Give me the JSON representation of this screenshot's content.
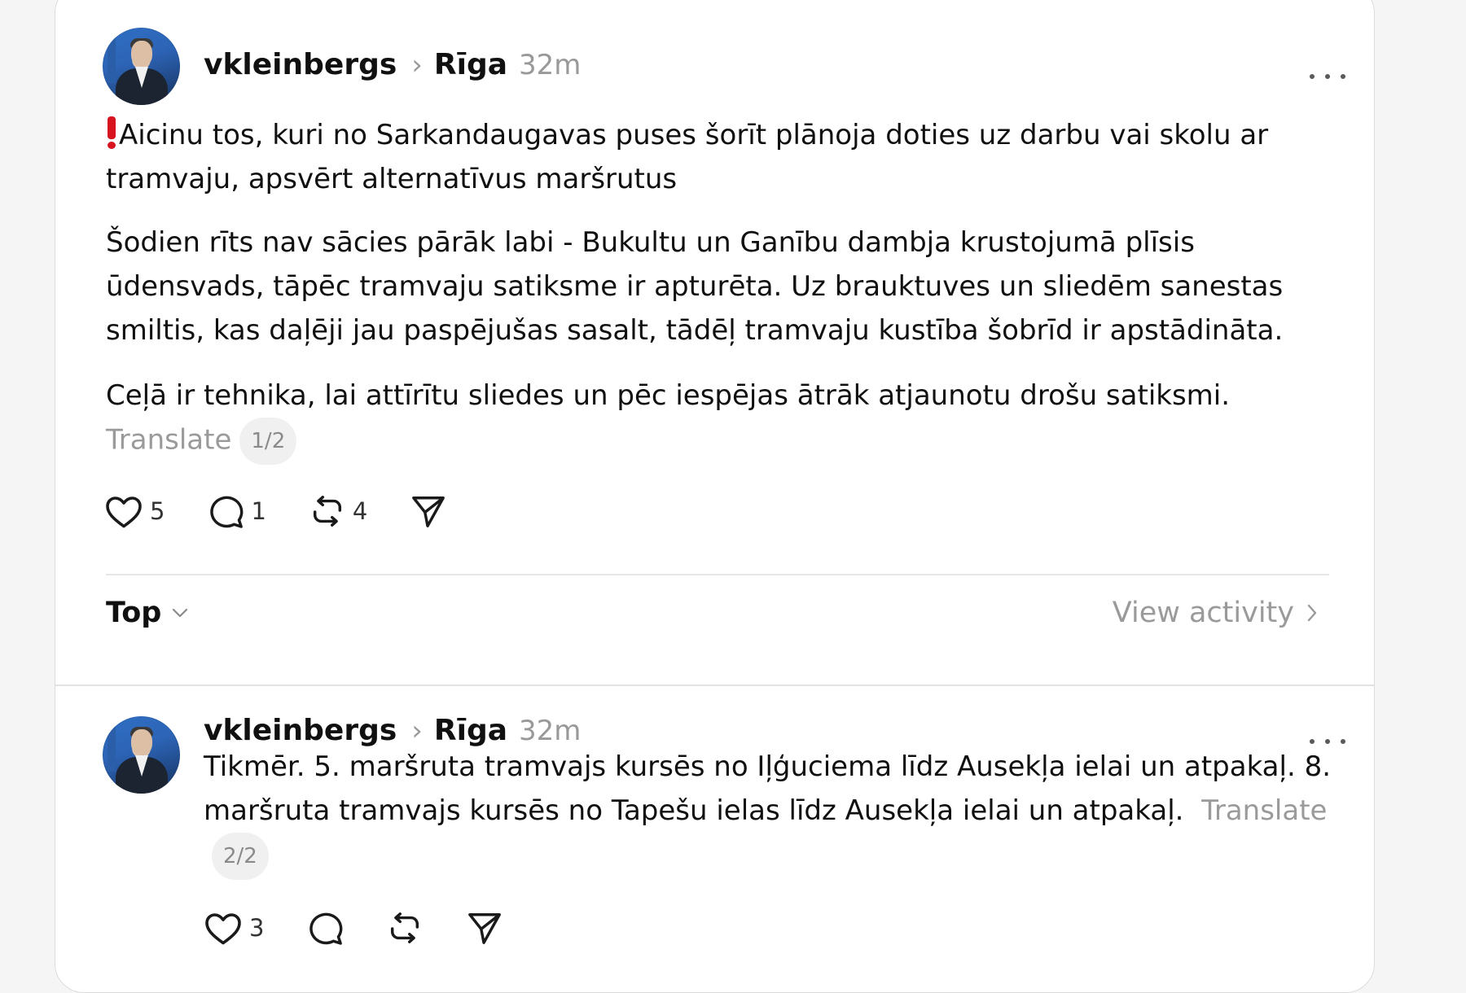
{
  "post": {
    "username": "vkleinbergs",
    "topic": "Rīga",
    "time": "32m",
    "paragraphs": [
      "Aicinu tos, kuri no Sarkandaugavas puses šorīt plānoja doties uz darbu vai skolu ar tramvaju, apsvērt alternatīvus maršrutus",
      "Šodien rīts nav sācies pārāk labi - Bukultu un Ganību dambja krustojumā plīsis ūdensvads, tāpēc tramvaju satiksme ir apturēta. Uz brauktuves un sliedēm sanestas smiltis, kas daļēji jau paspējušas sasalt, tādēļ tramvaju kustība šobrīd ir apstādināta.",
      "Ceļā ir tehnika, lai attīrītu sliedes un pēc iespējas ātrāk atjaunotu drošu satiksmi."
    ],
    "translate_label": "Translate",
    "thread_index": "1/2",
    "likes": "5",
    "replies": "1",
    "reposts": "4"
  },
  "activity_bar": {
    "sort_label": "Top",
    "view_activity_label": "View activity"
  },
  "reply": {
    "username": "vkleinbergs",
    "topic": "Rīga",
    "time": "32m",
    "text": "Tikmēr. 5. maršruta tramvajs kursēs no Iļģuciema līdz Ausekļa ielai un atpakaļ. 8. maršruta tramvajs kursēs no Tapešu ielas līdz Ausekļa ielai un atpakaļ.",
    "translate_label": "Translate",
    "thread_index": "2/2",
    "likes": "3"
  },
  "icons": {
    "more": "more-horizontal-icon",
    "like": "heart-icon",
    "reply": "comment-icon",
    "repost": "repost-icon",
    "share": "send-icon",
    "chevron_down": "chevron-down-icon",
    "chevron_right": "chevron-right-icon",
    "separator": "chevron-right-icon"
  }
}
